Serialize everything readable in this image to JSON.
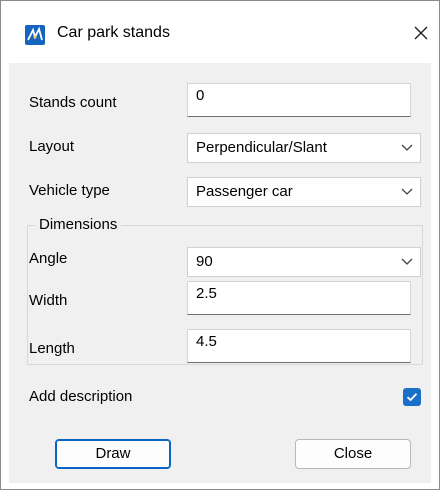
{
  "window": {
    "title": "Car park stands",
    "app_icon": "app-logo-icon",
    "close_icon": "close-icon"
  },
  "form": {
    "stands_count": {
      "label": "Stands count",
      "value": "0"
    },
    "layout": {
      "label": "Layout",
      "selected": "Perpendicular/Slant"
    },
    "vehicle_type": {
      "label": "Vehicle type",
      "selected": "Passenger car"
    },
    "dimensions": {
      "group_label": "Dimensions",
      "angle": {
        "label": "Angle",
        "selected": "90"
      },
      "width": {
        "label": "Width",
        "value": "2.5"
      },
      "length": {
        "label": "Length",
        "value": "4.5"
      }
    },
    "add_description": {
      "label": "Add description",
      "checked": true
    }
  },
  "buttons": {
    "draw": "Draw",
    "close": "Close"
  },
  "colors": {
    "accent": "#1a6fc9",
    "dialog_bg": "#f0f0f0"
  }
}
